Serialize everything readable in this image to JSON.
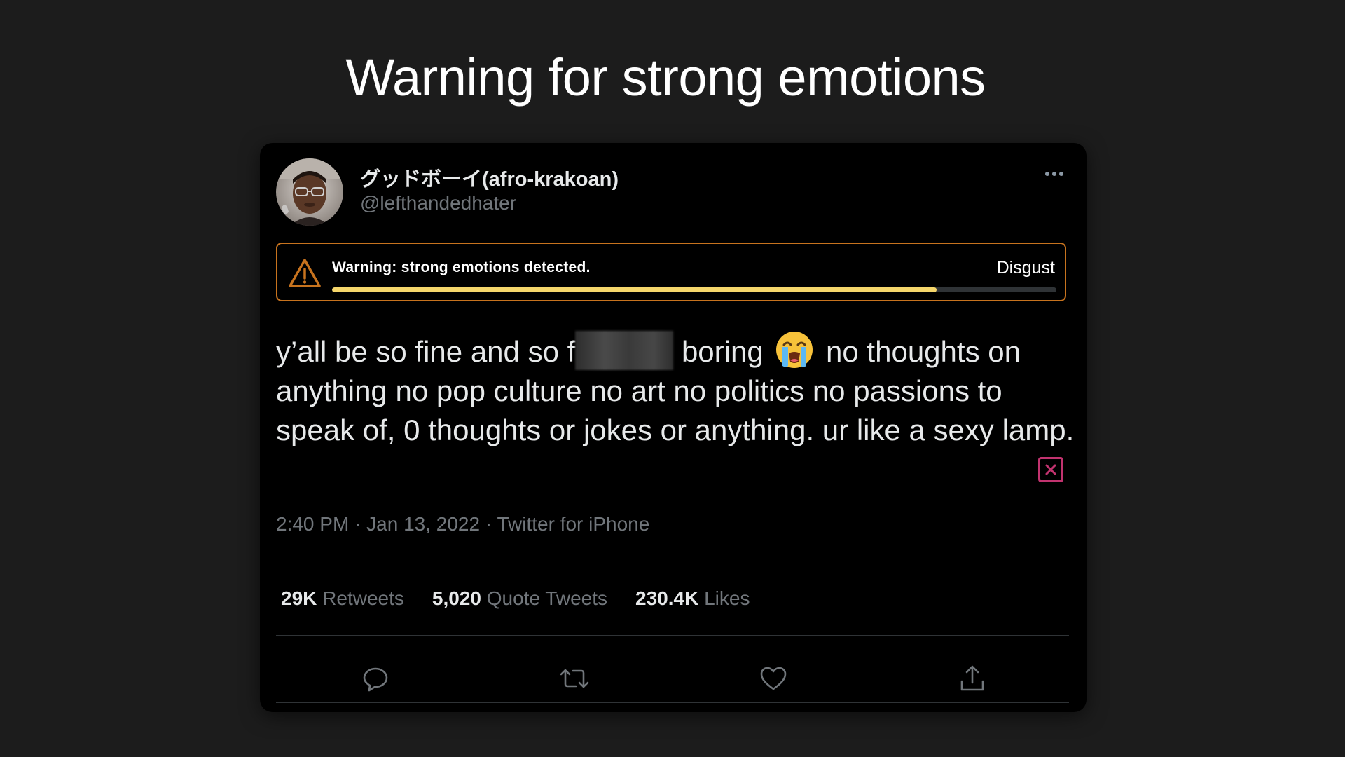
{
  "slide": {
    "title": "Warning for strong emotions"
  },
  "tweet": {
    "display_name": "グッドボーイ(afro-krakoan)",
    "handle": "@lefthandedhater",
    "warning": {
      "message": "Warning: strong emotions detected.",
      "emotion": "Disgust",
      "intensity": 0.835,
      "accent_color": "#c7731e",
      "bar_color": "#f5d66b"
    },
    "text": {
      "part1": "y’all be so fine and so f",
      "redacted": "",
      "part2": "boring",
      "emoji": "loudly-crying-face",
      "part3": "no thoughts on anything no pop culture no art no politics no passions to speak of, 0 thoughts or jokes or anything. ur like a sexy lamp."
    },
    "meta": "2:40 PM · Jan 13, 2022 · Twitter for iPhone",
    "stats": {
      "retweets_value": "29K",
      "retweets_label": "Retweets",
      "quotes_value": "5,020",
      "quotes_label": "Quote Tweets",
      "likes_value": "230.4K",
      "likes_label": "Likes"
    },
    "actions": {
      "reply_icon": "reply-icon",
      "retweet_icon": "retweet-icon",
      "like_icon": "like-icon",
      "share_icon": "share-icon"
    },
    "dismiss_color": "#c2336f"
  }
}
